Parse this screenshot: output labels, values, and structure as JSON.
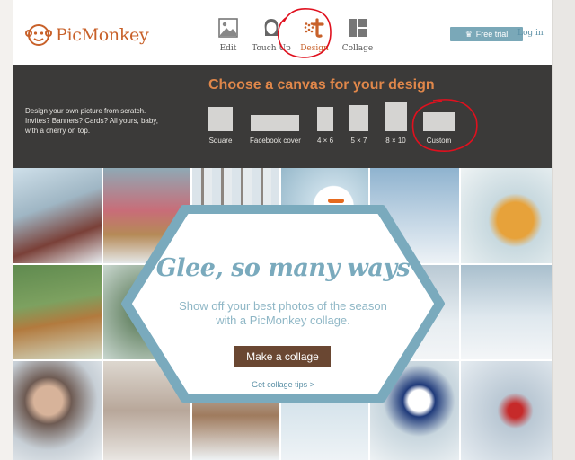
{
  "brand": {
    "name": "PicMonkey",
    "color": "#c8612a"
  },
  "header": {
    "tools": [
      {
        "label": "Edit",
        "icon": "image-icon"
      },
      {
        "label": "Touch Up",
        "icon": "face-icon"
      },
      {
        "label": "Design",
        "icon": "design-icon",
        "active": true
      },
      {
        "label": "Collage",
        "icon": "collage-icon"
      }
    ],
    "free_trial": "Free trial",
    "login": "Log in"
  },
  "canvas": {
    "title": "Choose a canvas for your design",
    "description": "Design your own picture from scratch. Invites? Banners? Cards? All yours, baby, with a cherry on top.",
    "options": [
      {
        "label": "Square"
      },
      {
        "label": "Facebook cover"
      },
      {
        "label": "4 × 6"
      },
      {
        "label": "5 × 7"
      },
      {
        "label": "8 × 10"
      },
      {
        "label": "Custom"
      }
    ]
  },
  "promo": {
    "title": "Glee, so many ways",
    "body": "Show off your best photos of the season with a PicMonkey collage.",
    "button": "Make a collage",
    "link": "Get collage tips >"
  },
  "colors": {
    "accent": "#c8612a",
    "band": "#3b3a39",
    "promo_blue": "#7aaabd",
    "button_brown": "#6a4732",
    "annotation_red": "#e0101e"
  }
}
